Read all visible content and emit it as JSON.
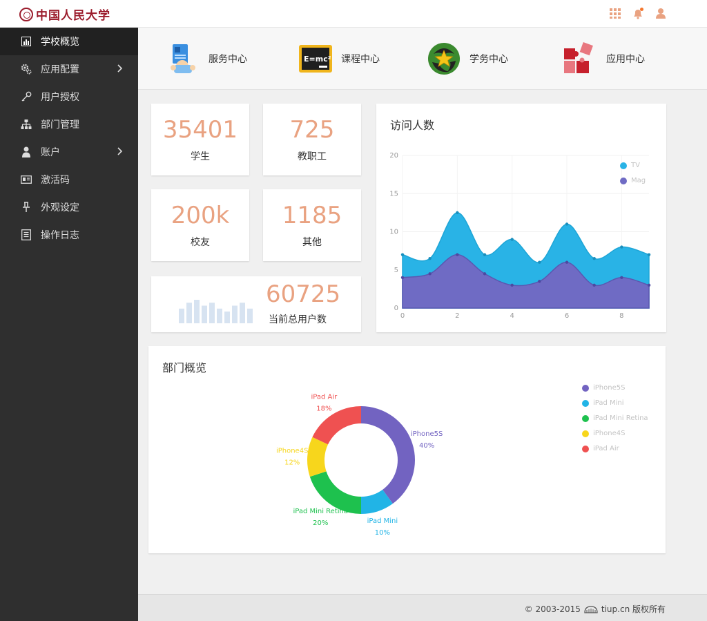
{
  "brand": {
    "logo_text": "中国人民大学"
  },
  "topbar": {
    "icons": [
      "grid-icon",
      "bell-icon",
      "user-icon"
    ],
    "accent": "#e9a281"
  },
  "sidebar": {
    "items": [
      {
        "label": "学校概览",
        "icon": "bar-chart-icon",
        "active": true
      },
      {
        "label": "应用配置",
        "icon": "gears-icon",
        "has_submenu": true
      },
      {
        "label": "用户授权",
        "icon": "key-icon"
      },
      {
        "label": "部门管理",
        "icon": "sitemap-icon"
      },
      {
        "label": "账户",
        "icon": "person-icon",
        "has_submenu": true
      },
      {
        "label": "激活码",
        "icon": "id-card-icon"
      },
      {
        "label": "外观设定",
        "icon": "pin-icon"
      },
      {
        "label": "操作日志",
        "icon": "document-icon"
      }
    ]
  },
  "shortcuts": [
    {
      "label": "服务中心",
      "icon": "service-icon"
    },
    {
      "label": "课程中心",
      "icon": "blackboard-icon",
      "icon_text": "E=mc²"
    },
    {
      "label": "学务中心",
      "icon": "star-badge-icon"
    },
    {
      "label": "应用中心",
      "icon": "puzzle-icon"
    }
  ],
  "stats": [
    {
      "value": "35401",
      "label": "学生"
    },
    {
      "value": "725",
      "label": "教职工"
    },
    {
      "value": "200k",
      "label": "校友"
    },
    {
      "value": "1185",
      "label": "其他"
    }
  ],
  "total_users": {
    "value": "60725",
    "label": "当前总用户数",
    "spark": [
      5,
      7,
      8,
      6,
      7,
      5,
      4,
      6,
      7,
      5
    ]
  },
  "visits_card": {
    "title": "访问人数"
  },
  "dept_card": {
    "title": "部门概览"
  },
  "chart_data": [
    {
      "type": "area",
      "x": [
        0,
        1,
        2,
        3,
        4,
        5,
        6,
        7,
        8,
        9
      ],
      "xticks": [
        "0",
        "2",
        "4",
        "6",
        "8"
      ],
      "yticks": [
        "0",
        "5",
        "10",
        "15",
        "20"
      ],
      "ylim": [
        0,
        20
      ],
      "xlim": [
        0,
        9
      ],
      "stacked": true,
      "legend_position": "top-right",
      "series": [
        {
          "name": "TV",
          "color": "#29b3e6",
          "values": [
            3,
            2,
            5.5,
            2.5,
            6,
            2.5,
            5,
            3.5,
            4,
            4
          ]
        },
        {
          "name": "Mag",
          "color": "#6f6bc4",
          "values": [
            4,
            4.5,
            7,
            4.5,
            3,
            3.5,
            6,
            3,
            4,
            3
          ]
        }
      ]
    },
    {
      "type": "pie",
      "donut": true,
      "legend_position": "top-right",
      "slices": [
        {
          "name": "iPhone5S",
          "value": 40,
          "label": "40%",
          "color": "#7263c1"
        },
        {
          "name": "iPad Mini",
          "value": 10,
          "label": "10%",
          "color": "#21b4e6"
        },
        {
          "name": "iPad Mini Retina",
          "value": 20,
          "label": "20%",
          "color": "#1ec14e"
        },
        {
          "name": "iPhone4S",
          "value": 12,
          "label": "12%",
          "color": "#f7d61c"
        },
        {
          "name": "iPad Air",
          "value": 18,
          "label": "18%",
          "color": "#ef5151"
        }
      ]
    }
  ],
  "footer": {
    "text_before": "© 2003-2015",
    "text_after": "tiup.cn 版权所有"
  }
}
